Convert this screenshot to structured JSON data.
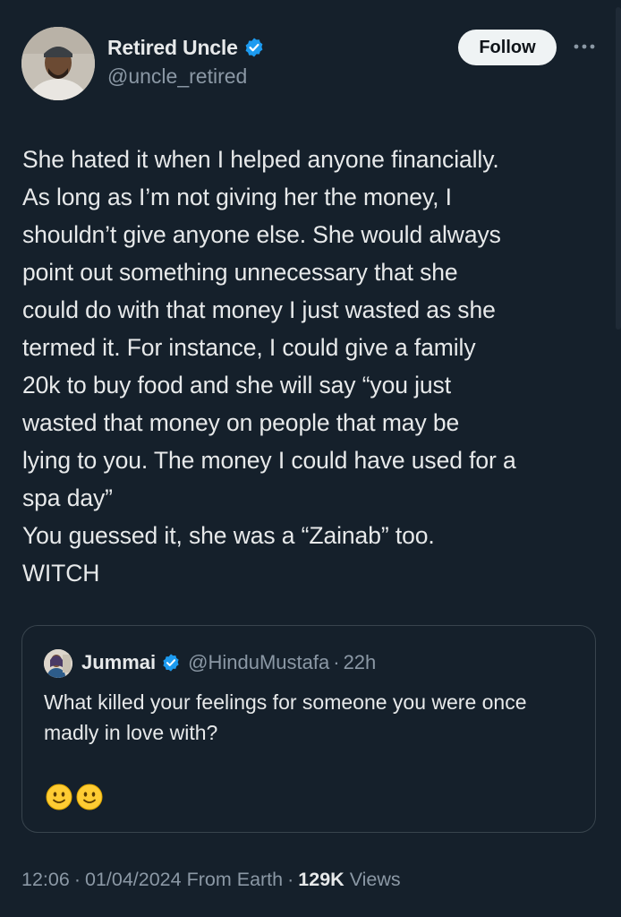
{
  "tweet": {
    "author": {
      "display_name": "Retired Uncle",
      "handle": "@uncle_retired",
      "verified": true
    },
    "follow_label": "Follow",
    "more_icon": "more-horizontal-icon",
    "text": "She hated it when I helped anyone financially.\nAs long as I’m not giving her the money, I\nshouldn’t give anyone else. She would always\npoint out something unnecessary that she\ncould do with that money I just wasted as she\ntermed it. For instance, I could give a family\n20k to buy food and she will say “you just\nwasted that money on people that may be\nlying to you. The money I could have used for a\nspa day”\nYou guessed it, she was a “Zainab” too.\nWITCH",
    "quoted": {
      "display_name": "Jummai",
      "handle": "@HinduMustafa",
      "separator": "·",
      "time": "22h",
      "verified": true,
      "text": "What killed your feelings for someone you were once madly in love with?",
      "emojis": [
        "slightly-smiling-face",
        "slightly-smiling-face"
      ]
    },
    "meta": {
      "time": "12:06",
      "sep1": "·",
      "date": "01/04/2024",
      "source": "From Earth",
      "sep2": "·",
      "views_count": "129K",
      "views_label": "Views"
    },
    "colors": {
      "background": "#15202b",
      "text": "#e7e9ea",
      "secondary": "#8b98a5",
      "verified_blue": "#1d9bf0",
      "border": "#38444d"
    }
  }
}
